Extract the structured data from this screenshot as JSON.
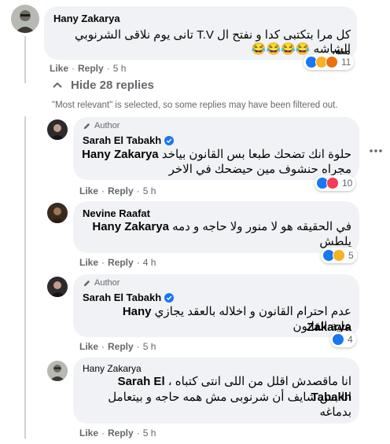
{
  "top_comment": {
    "author": "Hany Zakarya",
    "text_line1": "كل مرا بتكتبى كدا و نفتح ال T.V تانى يوم نلاقى الشرنوبي منور",
    "text_line2": "الشاشه 😂😂😂😂",
    "reaction_count": "11",
    "like": "Like",
    "reply": "Reply",
    "time": "5 h"
  },
  "replies_toggle": {
    "label": "Hide 28 replies",
    "filter_note": "\"Most relevant\" is selected, so some replies may have been filtered out."
  },
  "replies": [
    {
      "badge": "Author",
      "author": "Sarah El Tabakh",
      "mention": "Hany Zakarya",
      "text_line1": "حلوة انك تضحك طبعا بس القانون بياخد",
      "text_line2": "مجراه حنشوف مين حيضحك في الاخر",
      "reaction_count": "10",
      "like": "Like",
      "reply": "Reply",
      "time": "5 h"
    },
    {
      "author": "Nevine Raafat",
      "mention": "Hany Zakarya",
      "text_line1": "في الحقيقه هو لا منور ولا حاجه و دمه",
      "text_line2": "يلطش",
      "reaction_count": "5",
      "like": "Like",
      "reply": "Reply",
      "time": "4 h"
    },
    {
      "badge": "Author",
      "author": "Sarah El Tabakh",
      "mention": "Hany Zakarya",
      "text_line1": "عدم احترام القانون و اخلاله بالعقد يجازي",
      "text_line2": "علية القانون",
      "reaction_count": "4",
      "like": "Like",
      "reply": "Reply",
      "time": "5 h"
    },
    {
      "author": "Hany Zakarya",
      "mention": "Sarah El Tabakh",
      "text_line1": "انا ماقصدش اقلل من اللى انتى كتباه ،",
      "text_line2": "انا بس شايف أن شرنوبى مش همه حاجه و بيتعامل",
      "text_line3": "بدماغه",
      "like": "Like",
      "reply": "Reply",
      "time": "5 h"
    }
  ],
  "colors": {
    "bubble": "#f0f2f5",
    "meta_text": "#65676b",
    "like_blue": "#1877f2",
    "love_red": "#f33e58",
    "haha_yellow": "#f7b125"
  },
  "icons": [
    "pencil-icon",
    "verified-icon",
    "chevron-up-icon",
    "more-horizontal-icon",
    "like-reaction-icon",
    "love-reaction-icon",
    "haha-reaction-icon",
    "angry-reaction-icon"
  ]
}
